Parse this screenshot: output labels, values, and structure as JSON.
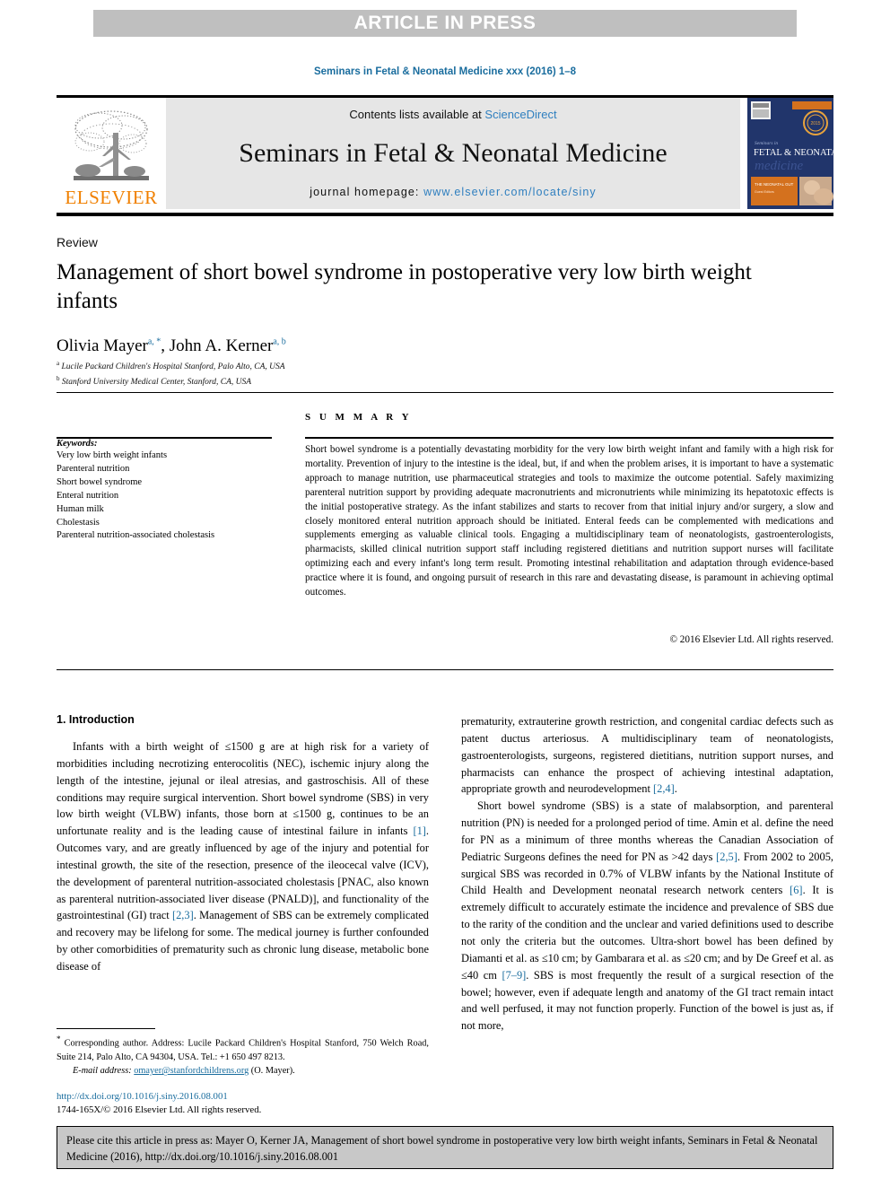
{
  "banner": {
    "text": "ARTICLE IN PRESS"
  },
  "running_head": "Seminars in Fetal & Neonatal Medicine xxx (2016) 1–8",
  "masthead": {
    "contents_prefix": "Contents lists available at ",
    "sciencedirect": "ScienceDirect",
    "journal_title": "Seminars in Fetal & Neonatal Medicine",
    "homepage_prefix": "journal homepage: ",
    "homepage_url": "www.elsevier.com/locate/siny",
    "publisher": "ELSEVIER",
    "cover_line1": "Seminars in",
    "cover_line2": "FETAL & NEONATAL",
    "cover_line3": "medicine"
  },
  "article": {
    "type": "Review",
    "title": "Management of short bowel syndrome in postoperative very low birth weight infants",
    "authors_1": "Olivia Mayer",
    "authors_1_sup": "a, *",
    "authors_sep": ", ",
    "authors_2": "John A. Kerner",
    "authors_2_sup": "a, b",
    "affiliation_a_mark": "a",
    "affiliation_a": "Lucile Packard Children's Hospital Stanford, Palo Alto, CA, USA",
    "affiliation_b_mark": "b",
    "affiliation_b": "Stanford University Medical Center, Stanford, CA, USA"
  },
  "keywords": {
    "heading": "Keywords:",
    "items": [
      "Very low birth weight infants",
      "Parenteral nutrition",
      "Short bowel syndrome",
      "Enteral nutrition",
      "Human milk",
      "Cholestasis",
      "Parenteral nutrition-associated cholestasis"
    ]
  },
  "summary": {
    "heading": "S U M M A R Y",
    "body": "Short bowel syndrome is a potentially devastating morbidity for the very low birth weight infant and family with a high risk for mortality. Prevention of injury to the intestine is the ideal, but, if and when the problem arises, it is important to have a systematic approach to manage nutrition, use pharmaceutical strategies and tools to maximize the outcome potential. Safely maximizing parenteral nutrition support by providing adequate macronutrients and micronutrients while minimizing its hepatotoxic effects is the initial postoperative strategy. As the infant stabilizes and starts to recover from that initial injury and/or surgery, a slow and closely monitored enteral nutrition approach should be initiated. Enteral feeds can be complemented with medications and supplements emerging as valuable clinical tools. Engaging a multidisciplinary team of neonatologists, gastroenterologists, pharmacists, skilled clinical nutrition support staff including registered dietitians and nutrition support nurses will facilitate optimizing each and every infant's long term result. Promoting intestinal rehabilitation and adaptation through evidence-based practice where it is found, and ongoing pursuit of research in this rare and devastating disease, is paramount in achieving optimal outcomes.",
    "copyright": "© 2016 Elsevier Ltd. All rights reserved."
  },
  "body": {
    "section_heading": "1. Introduction",
    "left_p1_a": "Infants with a birth weight of ≤1500 g are at high risk for a variety of morbidities including necrotizing enterocolitis (NEC), ischemic injury along the length of the intestine, jejunal or ileal atresias, and gastroschisis. All of these conditions may require surgical intervention. Short bowel syndrome (SBS) in very low birth weight (VLBW) infants, those born at ≤1500 g, continues to be an unfortunate reality and is the leading cause of intestinal failure in infants ",
    "left_ref1": "[1]",
    "left_p1_b": ". Outcomes vary, and are greatly influenced by age of the injury and potential for intestinal growth, the site of the resection, presence of the ileocecal valve (ICV), the development of parenteral nutrition-associated cholestasis [PNAC, also known as parenteral nutrition-associated liver disease (PNALD)], and functionality of the gastrointestinal (GI) tract ",
    "left_ref2": "[2,3]",
    "left_p1_c": ". Management of SBS can be extremely complicated and recovery may be lifelong for some. The medical journey is further confounded by other comorbidities of prematurity such as chronic lung disease, metabolic bone disease of",
    "right_p1_a": "prematurity, extrauterine growth restriction, and congenital cardiac defects such as patent ductus arteriosus. A multidisciplinary team of neonatologists, gastroenterologists, surgeons, registered dietitians, nutrition support nurses, and pharmacists can enhance the prospect of achieving intestinal adaptation, appropriate growth and neurodevelopment ",
    "right_ref1": "[2,4]",
    "right_p1_b": ".",
    "right_p2_a": "Short bowel syndrome (SBS) is a state of malabsorption, and parenteral nutrition (PN) is needed for a prolonged period of time. Amin et al. define the need for PN as a minimum of three months whereas the Canadian Association of Pediatric Surgeons defines the need for PN as >42 days ",
    "right_ref2": "[2,5]",
    "right_p2_b": ". From 2002 to 2005, surgical SBS was recorded in 0.7% of VLBW infants by the National Institute of Child Health and Development neonatal research network centers ",
    "right_ref3": "[6]",
    "right_p2_c": ". It is extremely difficult to accurately estimate the incidence and prevalence of SBS due to the rarity of the condition and the unclear and varied definitions used to describe not only the criteria but the outcomes. Ultra-short bowel has been defined by Diamanti et al. as ≤10 cm; by Gambarara et al. as ≤20 cm; and by De Greef et al. as ≤40 cm ",
    "right_ref4": "[7–9]",
    "right_p2_d": ". SBS is most frequently the result of a surgical resection of the bowel; however, even if adequate length and anatomy of the GI tract remain intact and well perfused, it may not function properly. Function of the bowel is just as, if not more,"
  },
  "footnote": {
    "star": "*",
    "corresponding": " Corresponding author. Address: Lucile Packard Children's Hospital Stanford, 750 Welch Road, Suite 214, Palo Alto, CA 94304, USA. Tel.: +1 650 497 8213.",
    "email_label": "E-mail address: ",
    "email": "omayer@stanfordchildrens.org",
    "email_suffix": " (O. Mayer)."
  },
  "doi": {
    "url": "http://dx.doi.org/10.1016/j.siny.2016.08.001",
    "issn_line": "1744-165X/© 2016 Elsevier Ltd. All rights reserved."
  },
  "cite_box": {
    "text": "Please cite this article in press as: Mayer O, Kerner JA, Management of short bowel syndrome in postoperative very low birth weight infants, Seminars in Fetal & Neonatal Medicine (2016), http://dx.doi.org/10.1016/j.siny.2016.08.001"
  },
  "colors": {
    "link": "#1a6d9e",
    "sciencedirect": "#2f7fbf",
    "elsevier_orange": "#f08000",
    "banner_bg": "#bfbfbf",
    "masthead_bg": "#e6e6e6",
    "cite_bg": "#c8c8c8"
  }
}
